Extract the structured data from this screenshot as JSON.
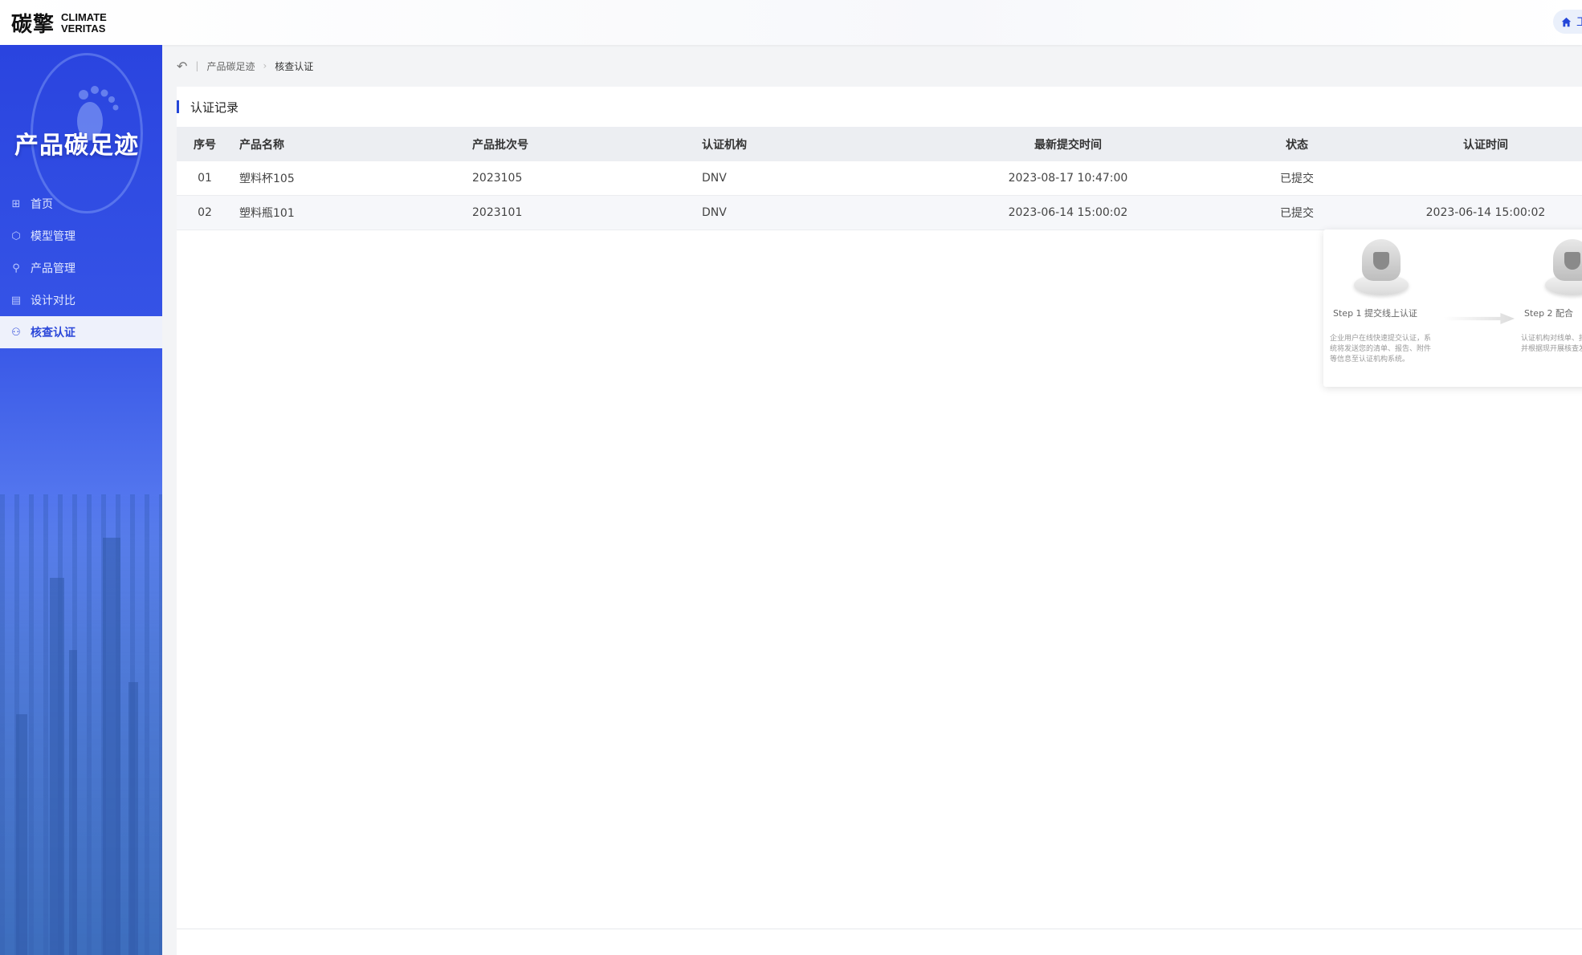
{
  "header": {
    "logo_cn": "碳擎",
    "logo_en_line1": "CLIMATE",
    "logo_en_line2": "VERITAS",
    "home_label": "工"
  },
  "sidebar": {
    "title": "产品碳足迹",
    "items": [
      {
        "label": "首页",
        "icon": "grid-icon"
      },
      {
        "label": "模型管理",
        "icon": "cube-icon"
      },
      {
        "label": "产品管理",
        "icon": "link-icon"
      },
      {
        "label": "设计对比",
        "icon": "compare-icon"
      },
      {
        "label": "核查认证",
        "icon": "user-icon",
        "active": true
      }
    ]
  },
  "breadcrumb": {
    "items": [
      "产品碳足迹",
      "核查认证"
    ]
  },
  "section": {
    "title": "认证记录"
  },
  "table": {
    "headers": [
      "序号",
      "产品名称",
      "产品批次号",
      "认证机构",
      "最新提交时间",
      "状态",
      "认证时间"
    ],
    "rows": [
      [
        "01",
        "塑料杯105",
        "2023105",
        "DNV",
        "2023-08-17 10:47:00",
        "已提交",
        ""
      ],
      [
        "02",
        "塑料瓶101",
        "2023101",
        "DNV",
        "2023-06-14 15:00:02",
        "已提交",
        "2023-06-14 15:00:02"
      ]
    ]
  },
  "steps": [
    {
      "title": "Step 1 提交线上认证",
      "desc": "企业用户在线快速提交认证，系统将发送您的清单、报告、附件等信息至认证机构系统。"
    },
    {
      "title": "Step 2 配合",
      "desc": "认证机构对线单、报告、附带，并根据现开展核查发现"
    }
  ],
  "colors": {
    "accent": "#2446d8",
    "sidebar_top": "#2a44df",
    "active_bg": "#eef1fb"
  }
}
